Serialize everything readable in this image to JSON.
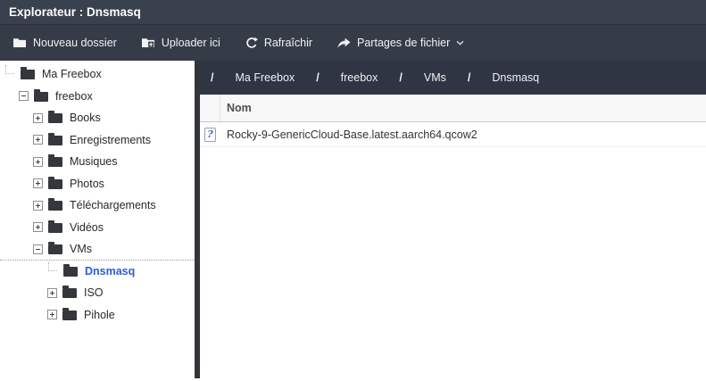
{
  "window": {
    "title": "Explorateur : Dnsmasq"
  },
  "toolbar": {
    "buttons": [
      {
        "label": "Nouveau dossier",
        "icon": "folder-icon"
      },
      {
        "label": "Uploader ici",
        "icon": "folder-plus-icon"
      },
      {
        "label": "Rafraîchir",
        "icon": "refresh-icon"
      },
      {
        "label": "Partages de fichier",
        "icon": "share-icon",
        "has_dropdown": true
      }
    ]
  },
  "sidebar": {
    "tree": [
      {
        "label": "Ma Freebox",
        "level": 0,
        "expander": "none",
        "selected": false
      },
      {
        "label": "freebox",
        "level": 1,
        "expander": "minus",
        "selected": false
      },
      {
        "label": "Books",
        "level": 2,
        "expander": "plus",
        "selected": false
      },
      {
        "label": "Enregistrements",
        "level": 2,
        "expander": "plus",
        "selected": false
      },
      {
        "label": "Musiques",
        "level": 2,
        "expander": "plus",
        "selected": false
      },
      {
        "label": "Photos",
        "level": 2,
        "expander": "plus",
        "selected": false
      },
      {
        "label": "Téléchargements",
        "level": 2,
        "expander": "plus",
        "selected": false
      },
      {
        "label": "Vidéos",
        "level": 2,
        "expander": "plus",
        "selected": false
      },
      {
        "label": "VMs",
        "level": 2,
        "expander": "minus",
        "selected": false
      },
      {
        "label": "Dnsmasq",
        "level": 3,
        "expander": "none",
        "selected": true
      },
      {
        "label": "ISO",
        "level": 3,
        "expander": "plus",
        "selected": false
      },
      {
        "label": "Pihole",
        "level": 3,
        "expander": "plus",
        "selected": false
      }
    ]
  },
  "breadcrumb": {
    "separator": "/",
    "segments": [
      "Ma Freebox",
      "freebox",
      "VMs",
      "Dnsmasq"
    ]
  },
  "filelist": {
    "header": {
      "name_column": "Nom"
    },
    "rows": [
      {
        "name": "Rocky-9-GenericCloud-Base.latest.aarch64.qcow2",
        "icon": "unknown-file-icon"
      }
    ]
  },
  "colors": {
    "titlebar_bg": "#3a414e",
    "toolbar_bg": "#353c48",
    "breadcrumb_bg": "#2f3542",
    "selected_text": "#2b5cd3",
    "sidebar_divider": "#323539"
  }
}
